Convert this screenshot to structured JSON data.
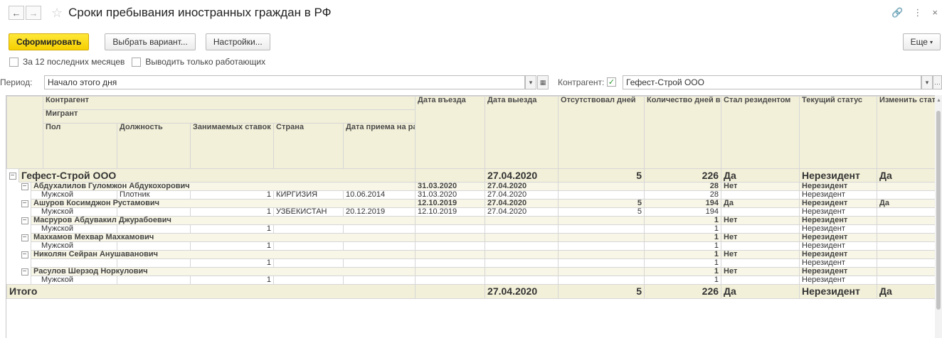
{
  "window": {
    "back_icon": "arrow-left-icon",
    "forward_icon": "arrow-right-icon",
    "star_icon": "star-icon",
    "title": "Сроки пребывания иностранных граждан в РФ",
    "link_icon": "link-icon",
    "menu_icon": "more-vert-icon",
    "close_icon": "close-icon"
  },
  "toolbar": {
    "generate": "Сформировать",
    "variant": "Выбрать вариант...",
    "settings": "Настройки...",
    "more": "Еще"
  },
  "options": {
    "last12": "За 12 последних месяцев",
    "last12_checked": false,
    "only_working": "Выводить только работающих",
    "only_working_checked": false
  },
  "filters": {
    "period_label": "Период:",
    "period_value": "Начало этого дня",
    "counterparty_label": "Контрагент:",
    "counterparty_checked": true,
    "counterparty_value": "Гефест-Строй ООО"
  },
  "table": {
    "headers": {
      "counterparty": "Контрагент",
      "migrant": "Мигрант",
      "gender": "Пол",
      "position": "Должность",
      "rates": "Занимаемых ставок",
      "country": "Страна",
      "hire_date": "Дата приема на работу",
      "entry": "Дата въезда",
      "exit": "Дата выезда",
      "absent": "Отсутствовал дней",
      "days": "Количество дней в РФ",
      "resident": "Стал резидентом",
      "status": "Текущий статус",
      "change": "Изменить статус"
    },
    "group": {
      "name": "Гефест-Строй ООО",
      "exit": "27.04.2020",
      "absent": "5",
      "days": "226",
      "resident": "Да",
      "status": "Нерезидент",
      "change": "Да"
    },
    "migrants": [
      {
        "name": "Абдухалилов Гуломжон Абдукохорович",
        "entry": "31.03.2020",
        "exit": "27.04.2020",
        "absent": "",
        "days": "28",
        "resident": "Нет",
        "status": "Нерезидент",
        "change": "",
        "gender": "Мужской",
        "position": "Плотник",
        "rates": "1",
        "country": "КИРГИЗИЯ",
        "hire": "10.06.2014",
        "d_entry": "31.03.2020",
        "d_exit": "27.04.2020",
        "d_absent": "",
        "d_days": "28",
        "d_status": "Нерезидент"
      },
      {
        "name": "Ашуров Косимджон Рустамович",
        "entry": "12.10.2019",
        "exit": "27.04.2020",
        "absent": "5",
        "days": "194",
        "resident": "Да",
        "status": "Нерезидент",
        "change": "Да",
        "gender": "Мужской",
        "position": "",
        "rates": "1",
        "country": "УЗБЕКИСТАН",
        "hire": "20.12.2019",
        "d_entry": "12.10.2019",
        "d_exit": "27.04.2020",
        "d_absent": "5",
        "d_days": "194",
        "d_status": "Нерезидент"
      },
      {
        "name": "Масруров Абдувакил Джурабоевич",
        "entry": "",
        "exit": "",
        "absent": "",
        "days": "1",
        "resident": "Нет",
        "status": "Нерезидент",
        "change": "",
        "gender": "Мужской",
        "position": "",
        "rates": "1",
        "country": "",
        "hire": "",
        "d_entry": "",
        "d_exit": "",
        "d_absent": "",
        "d_days": "1",
        "d_status": "Нерезидент"
      },
      {
        "name": "Махкамов Мехвар Махкамович",
        "entry": "",
        "exit": "",
        "absent": "",
        "days": "1",
        "resident": "Нет",
        "status": "Нерезидент",
        "change": "",
        "gender": "Мужской",
        "position": "",
        "rates": "1",
        "country": "",
        "hire": "",
        "d_entry": "",
        "d_exit": "",
        "d_absent": "",
        "d_days": "1",
        "d_status": "Нерезидент"
      },
      {
        "name": "Николян Сейран Анушаванович",
        "entry": "",
        "exit": "",
        "absent": "",
        "days": "1",
        "resident": "Нет",
        "status": "Нерезидент",
        "change": "",
        "gender": "",
        "position": "",
        "rates": "1",
        "country": "",
        "hire": "",
        "d_entry": "",
        "d_exit": "",
        "d_absent": "",
        "d_days": "1",
        "d_status": "Нерезидент"
      },
      {
        "name": "Расулов Шерзод Норкулович",
        "entry": "",
        "exit": "",
        "absent": "",
        "days": "1",
        "resident": "Нет",
        "status": "Нерезидент",
        "change": "",
        "gender": "Мужской",
        "position": "",
        "rates": "1",
        "country": "",
        "hire": "",
        "d_entry": "",
        "d_exit": "",
        "d_absent": "",
        "d_days": "1",
        "d_status": "Нерезидент"
      }
    ],
    "total": {
      "label": "Итого",
      "exit": "27.04.2020",
      "absent": "5",
      "days": "226",
      "resident": "Да",
      "status": "Нерезидент",
      "change": "Да"
    },
    "toggle_symbol": "−"
  }
}
